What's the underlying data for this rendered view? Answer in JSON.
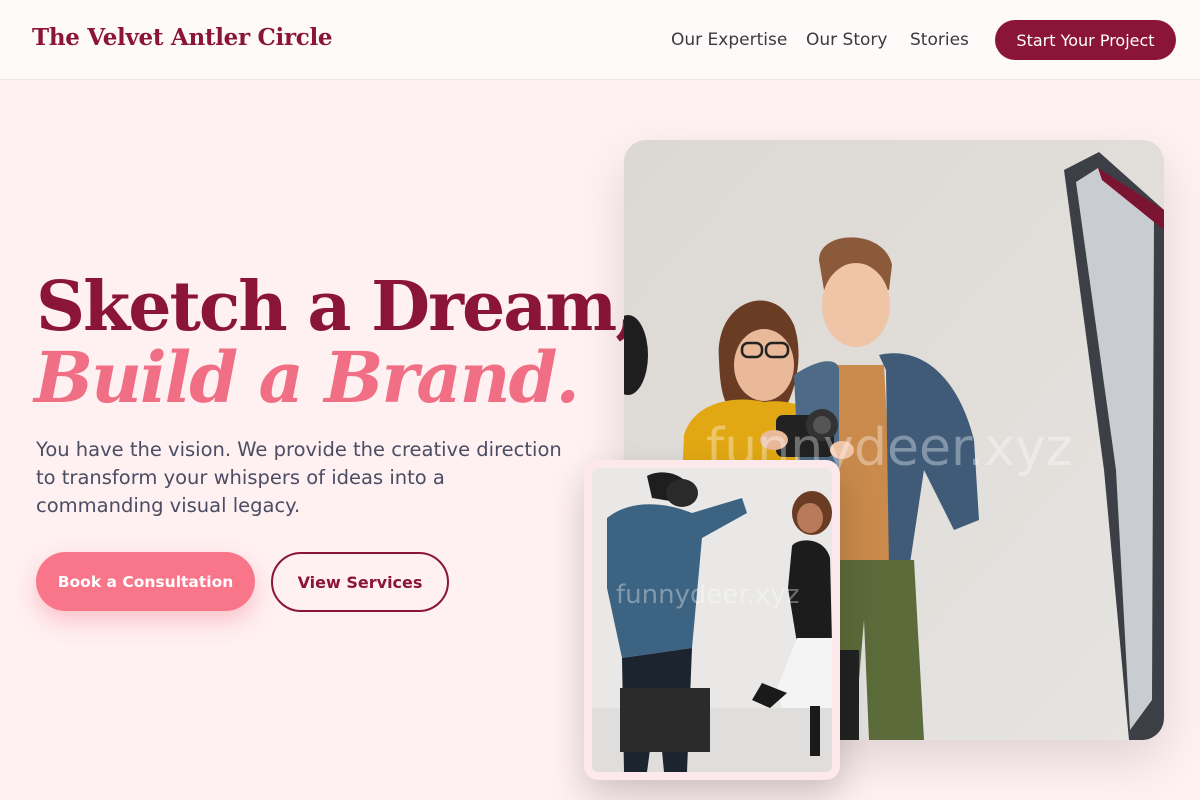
{
  "header": {
    "brand": "The Velvet Antler Circle",
    "nav": [
      {
        "label": "Our Expertise"
      },
      {
        "label": "Our Story"
      },
      {
        "label": "Stories"
      }
    ],
    "cta_label": "Start Your Project"
  },
  "hero": {
    "headline_line1": "Sketch a Dream,",
    "headline_line2": "Build a Brand.",
    "lead": "You have the vision. We provide the creative direction to transform your whispers of ideas into a commanding visual legacy.",
    "primary_button": "Book a Consultation",
    "secondary_button": "View Services"
  },
  "images": {
    "main_alt": "photographer-and-model-reviewing-camera",
    "main_watermark": "funnydeer.xyz",
    "small_alt": "photographer-shooting-dancing-model",
    "small_watermark": "funnydeer.xyz"
  },
  "colors": {
    "brand": "#8a1538",
    "accent": "#f06f84",
    "button_primary": "#f9768a",
    "background": "#fff0f1"
  }
}
